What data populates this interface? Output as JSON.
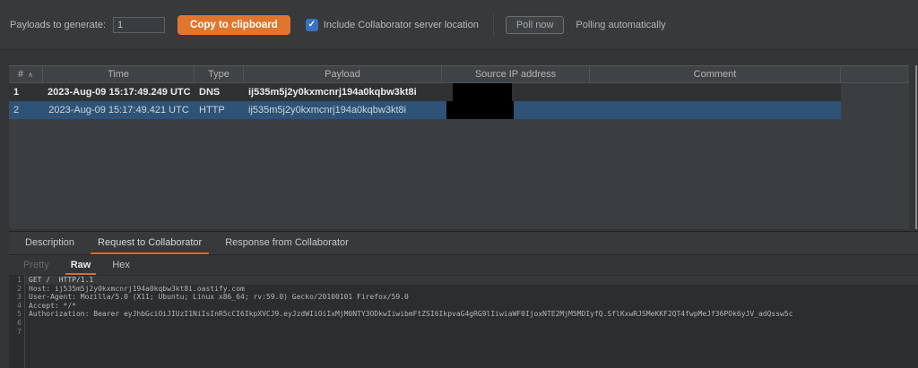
{
  "toolbar": {
    "payloads_label": "Payloads to generate:",
    "payloads_value": "1",
    "copy_button_label": "Copy to clipboard",
    "include_location_label": "Include Collaborator server location",
    "include_location_checked": true,
    "poll_now_label": "Poll now",
    "polling_status": "Polling automatically"
  },
  "icons": {
    "checkmark": "✓",
    "sort_asc": "∧"
  },
  "table": {
    "headers": {
      "num": "#",
      "time": "Time",
      "type": "Type",
      "payload": "Payload",
      "source_ip": "Source IP address",
      "comment": "Comment"
    },
    "rows": [
      {
        "num": "1",
        "time": "2023-Aug-09 15:17:49.249 UTC",
        "type": "DNS",
        "payload": "ij535m5j2y0kxmcnrj194a0kqbw3kt8i",
        "source_ip": "[redacted]",
        "comment": "",
        "unread": true,
        "selected": false
      },
      {
        "num": "2",
        "time": "2023-Aug-09 15:17:49.421 UTC",
        "type": "HTTP",
        "payload": "ij535m5j2y0kxmcnrj194a0kqbw3kt8i",
        "source_ip": "[redacted]",
        "comment": "",
        "unread": false,
        "selected": true
      }
    ]
  },
  "detail_tabs": {
    "description": "Description",
    "request": "Request to Collaborator",
    "response": "Response from Collaborator",
    "active": "Request to Collaborator"
  },
  "editor_tabs": {
    "pretty": "Pretty",
    "raw": "Raw",
    "hex": "Hex",
    "active": "Raw"
  },
  "request_editor": {
    "lines": [
      {
        "n": "1",
        "text": "GET /  HTTP/1.1"
      },
      {
        "n": "2",
        "text": "Host: ij535m5j2y0kxmcnrj194a0kqbw3kt8i.oastify.com"
      },
      {
        "n": "3",
        "text": "User-Agent: Mozilla/5.0 (X11; Ubuntu; Linux x86_64; rv:59.0) Gecko/20100101 Firefox/59.0"
      },
      {
        "n": "4",
        "text": "Accept: */*"
      },
      {
        "n": "5",
        "text": "Authorization: Bearer eyJhbGciOiJIUzI1NiIsInR5cCI6IkpXVCJ9.eyJzdWIiOiIxMjM0NTY3ODkwIiwibmFtZSI6IkpvaG4gRG9lIiwiaWF0IjoxNTE2MjM5MDIyfQ.SflKxwRJSMeKKF2QT4fwpMeJf36POk6yJV_adQssw5c"
      },
      {
        "n": "6",
        "text": ""
      },
      {
        "n": "7",
        "text": ""
      }
    ]
  },
  "colors": {
    "accent_orange": "#e0752d",
    "tab_underline_orange": "#dd6b20",
    "selection_blue": "#2e5377",
    "checkbox_blue": "#3a70c2",
    "redaction_black": "#000000",
    "background_dark": "#333537",
    "editor_background": "#2b2d2f"
  }
}
